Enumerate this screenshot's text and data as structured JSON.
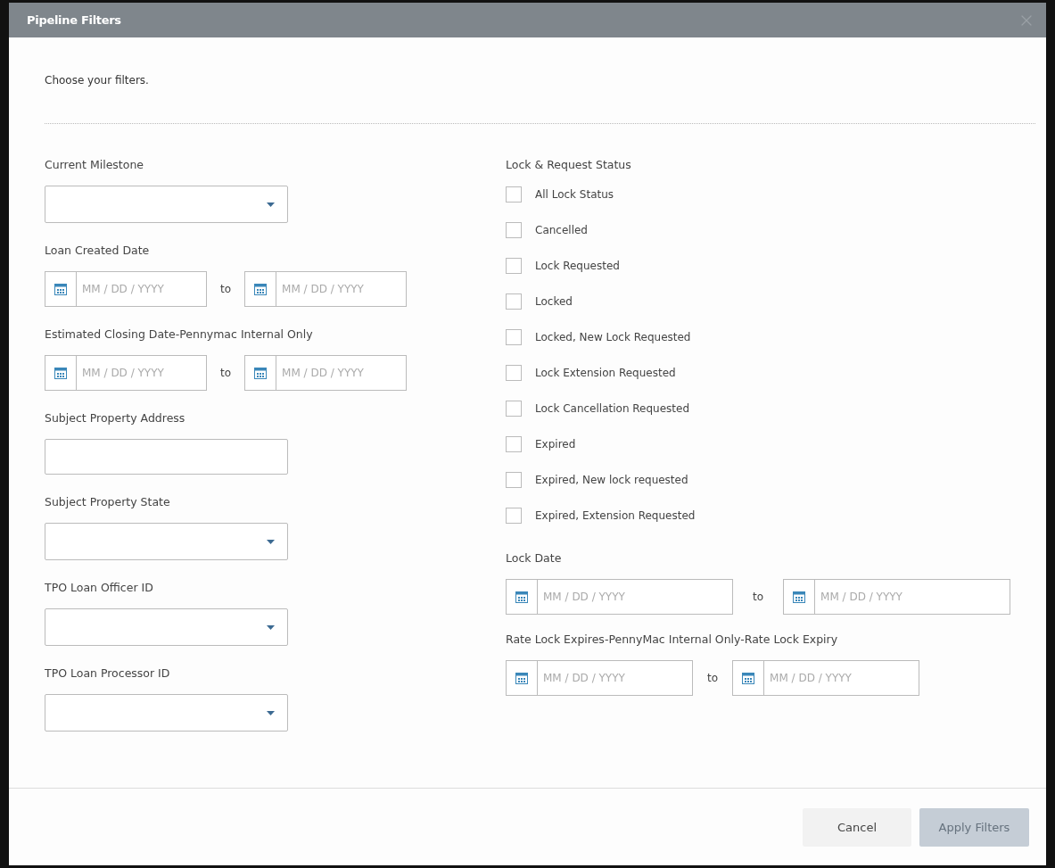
{
  "dialog": {
    "title": "Pipeline Filters",
    "intro": "Choose your filters."
  },
  "left_fields": [
    {
      "kind": "select",
      "label": "Current Milestone"
    },
    {
      "kind": "date_range",
      "label": "Loan Created Date",
      "from_placeholder": "MM / DD / YYYY",
      "separator": "to",
      "to_placeholder": "MM / DD / YYYY"
    },
    {
      "kind": "date_range",
      "label": "Estimated Closing Date-Pennymac Internal Only",
      "from_placeholder": "MM / DD / YYYY",
      "separator": "to",
      "to_placeholder": "MM / DD / YYYY"
    },
    {
      "kind": "text",
      "label": "Subject Property Address"
    },
    {
      "kind": "select",
      "label": "Subject Property State"
    },
    {
      "kind": "select",
      "label": "TPO Loan Officer ID"
    },
    {
      "kind": "select",
      "label": "TPO Loan Processor ID"
    }
  ],
  "lock_status": {
    "label": "Lock & Request Status",
    "options": [
      {
        "label": "All Lock Status",
        "checked": false
      },
      {
        "label": "Cancelled",
        "checked": false
      },
      {
        "label": "Lock Requested",
        "checked": false
      },
      {
        "label": "Locked",
        "checked": false
      },
      {
        "label": "Locked, New Lock Requested",
        "checked": false
      },
      {
        "label": "Lock Extension Requested",
        "checked": false
      },
      {
        "label": "Lock Cancellation Requested",
        "checked": false
      },
      {
        "label": "Expired",
        "checked": false
      },
      {
        "label": "Expired, New lock requested",
        "checked": false
      },
      {
        "label": "Expired, Extension Requested",
        "checked": false
      }
    ]
  },
  "right_fields": [
    {
      "kind": "date_range",
      "label": "Lock Date",
      "from_placeholder": "MM / DD / YYYY",
      "separator": "to",
      "to_placeholder": "MM / DD / YYYY"
    },
    {
      "kind": "date_range",
      "label": "Rate Lock Expires-PennyMac Internal Only-Rate Lock Expiry",
      "from_placeholder": "MM / DD / YYYY",
      "separator": "to",
      "to_placeholder": "MM / DD / YYYY"
    }
  ],
  "buttons": [
    {
      "label": "Cancel",
      "disabled": false
    },
    {
      "label": "Apply Filters",
      "disabled": true
    }
  ]
}
